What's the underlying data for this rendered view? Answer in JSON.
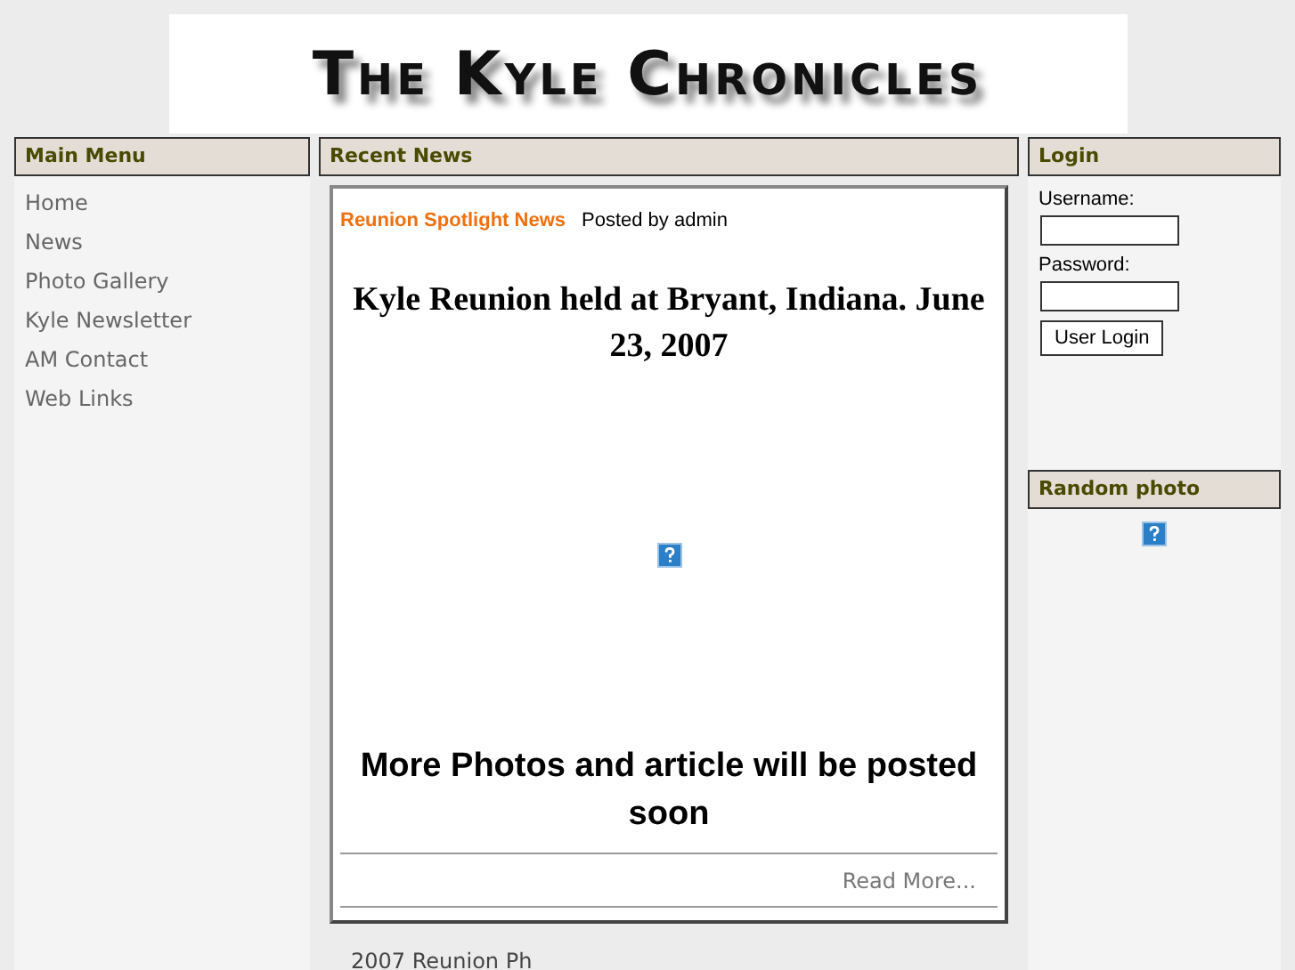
{
  "header": {
    "logo": "The Kyle Chronicles"
  },
  "main_menu": {
    "title": "Main Menu",
    "items": [
      {
        "label": "Home"
      },
      {
        "label": "News"
      },
      {
        "label": "Photo Gallery"
      },
      {
        "label": "Kyle Newsletter"
      },
      {
        "label": "AM Contact"
      },
      {
        "label": "Web Links"
      }
    ]
  },
  "recent_news": {
    "title": "Recent News",
    "category": "Reunion Spotlight News",
    "byline": "Posted by admin",
    "headline": "Kyle Reunion held at Bryant, Indiana. June 23, 2007",
    "note": "More Photos and article will be posted soon",
    "read_more": "Read More...",
    "next_title": "2007 Reunion Ph"
  },
  "login": {
    "title": "Login",
    "username_label": "Username:",
    "password_label": "Password:",
    "button": "User Login"
  },
  "random_photo": {
    "title": "Random photo"
  }
}
